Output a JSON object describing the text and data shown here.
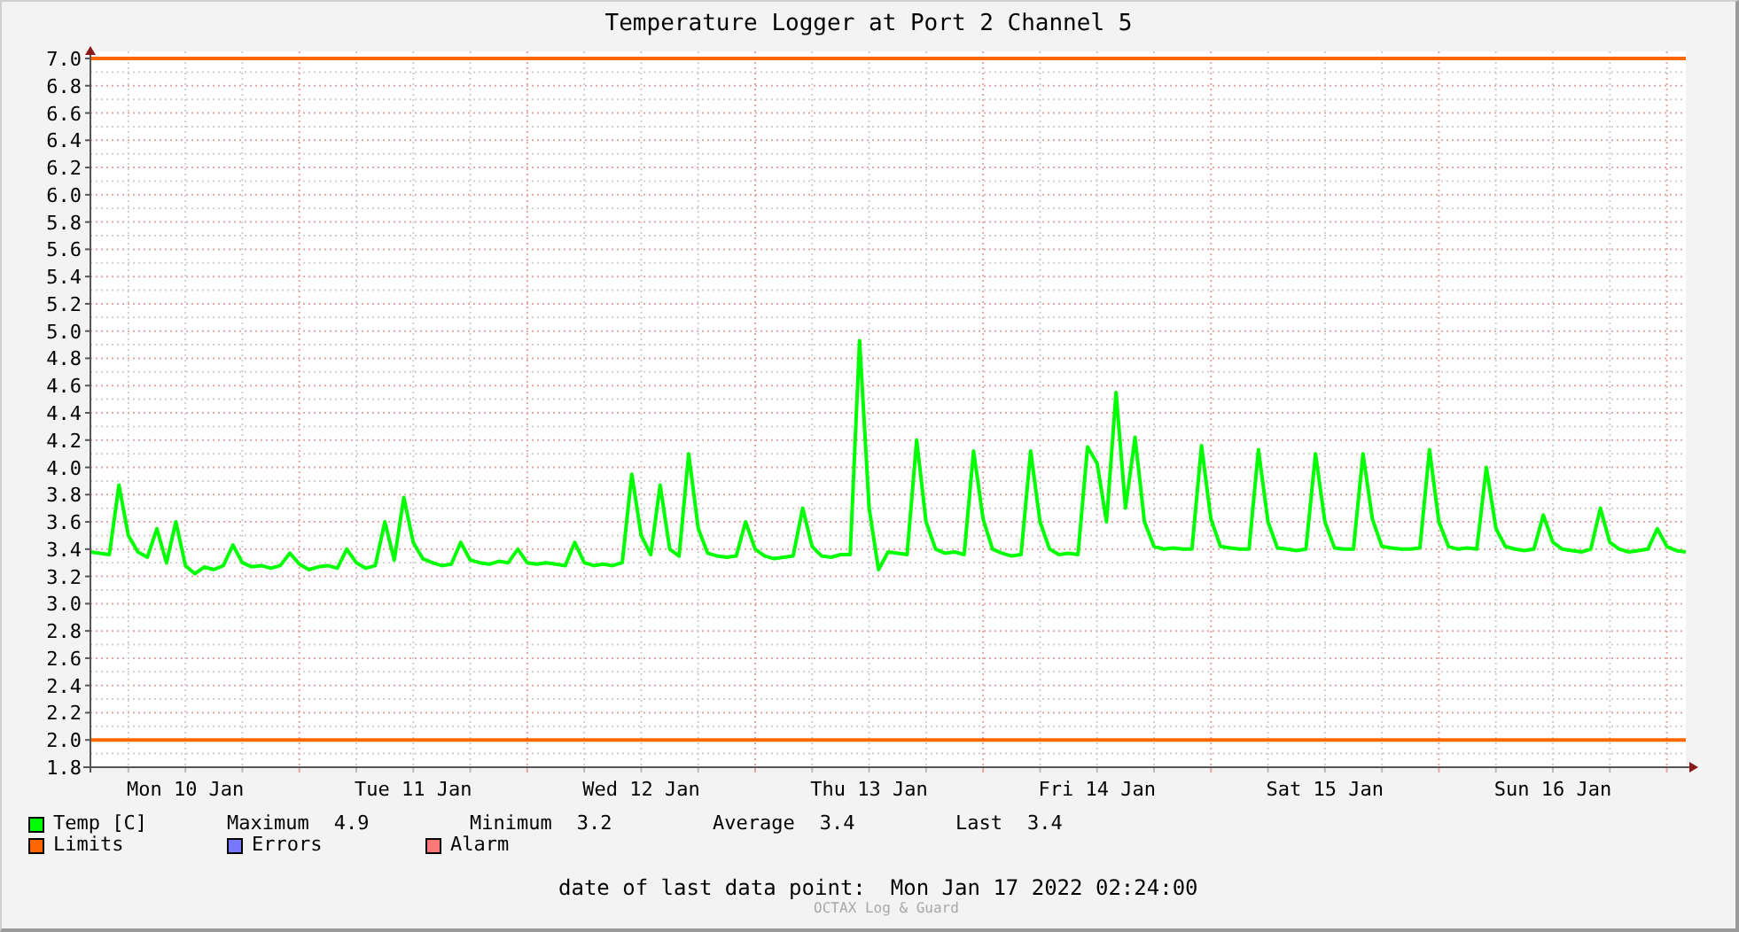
{
  "title": "Temperature Logger at Port 2 Channel 5",
  "chart_data": {
    "type": "line",
    "categories": [
      null,
      null,
      null,
      null,
      null,
      null,
      null,
      null,
      null,
      null,
      "Mon 10 Jan",
      null,
      null,
      null,
      null,
      null,
      null,
      null,
      null,
      null,
      null,
      null,
      null,
      null,
      null,
      null,
      null,
      null,
      null,
      null,
      null,
      null,
      null,
      null,
      "Tue 11 Jan",
      null,
      null,
      null,
      null,
      null,
      null,
      null,
      null,
      null,
      null,
      null,
      null,
      null,
      null,
      null,
      null,
      null,
      null,
      null,
      null,
      null,
      null,
      null,
      "Wed 12 Jan",
      null,
      null,
      null,
      null,
      null,
      null,
      null,
      null,
      null,
      null,
      null,
      null,
      null,
      null,
      null,
      null,
      null,
      null,
      null,
      null,
      null,
      null,
      null,
      "Thu 13 Jan",
      null,
      null,
      null,
      null,
      null,
      null,
      null,
      null,
      null,
      null,
      null,
      null,
      null,
      null,
      null,
      null,
      null,
      null,
      null,
      null,
      null,
      null,
      null,
      "Fri 14 Jan",
      null,
      null,
      null,
      null,
      null,
      null,
      null,
      null,
      null,
      null,
      null,
      null,
      null,
      null,
      null,
      null,
      null,
      null,
      null,
      null,
      null,
      null,
      null,
      "Sat 15 Jan",
      null,
      null,
      null,
      null,
      null,
      null,
      null,
      null,
      null,
      null,
      null,
      null,
      null,
      null,
      null,
      null,
      null,
      null,
      null,
      null,
      null,
      null,
      null,
      "Sun 16 Jan",
      null,
      null,
      null,
      null,
      null,
      null,
      null,
      null,
      null,
      null,
      null,
      null,
      null,
      null
    ],
    "series": [
      {
        "name": "Temp [C]",
        "color": "#00ff00",
        "values": [
          3.38,
          3.37,
          3.36,
          3.87,
          3.5,
          3.38,
          3.34,
          3.55,
          3.3,
          3.6,
          3.28,
          3.22,
          3.27,
          3.25,
          3.28,
          3.43,
          3.3,
          3.27,
          3.28,
          3.26,
          3.28,
          3.37,
          3.29,
          3.25,
          3.27,
          3.28,
          3.26,
          3.4,
          3.3,
          3.26,
          3.28,
          3.6,
          3.32,
          3.78,
          3.45,
          3.33,
          3.3,
          3.28,
          3.29,
          3.45,
          3.32,
          3.3,
          3.29,
          3.31,
          3.3,
          3.4,
          3.3,
          3.29,
          3.3,
          3.29,
          3.28,
          3.45,
          3.3,
          3.28,
          3.29,
          3.28,
          3.3,
          3.95,
          3.5,
          3.36,
          3.87,
          3.4,
          3.35,
          4.1,
          3.55,
          3.37,
          3.35,
          3.34,
          3.35,
          3.6,
          3.4,
          3.35,
          3.33,
          3.34,
          3.35,
          3.7,
          3.42,
          3.35,
          3.34,
          3.36,
          3.36,
          4.93,
          3.7,
          3.25,
          3.38,
          3.37,
          3.36,
          4.2,
          3.6,
          3.4,
          3.37,
          3.38,
          3.36,
          4.12,
          3.62,
          3.4,
          3.37,
          3.35,
          3.36,
          4.12,
          3.6,
          3.4,
          3.36,
          3.37,
          3.36,
          4.15,
          4.03,
          3.6,
          4.55,
          3.7,
          4.22,
          3.6,
          3.42,
          3.4,
          3.41,
          3.4,
          3.4,
          4.16,
          3.62,
          3.42,
          3.41,
          3.4,
          3.4,
          4.13,
          3.6,
          3.41,
          3.4,
          3.39,
          3.4,
          4.1,
          3.6,
          3.41,
          3.4,
          3.4,
          4.1,
          3.62,
          3.42,
          3.41,
          3.4,
          3.4,
          3.41,
          4.13,
          3.6,
          3.42,
          3.4,
          3.41,
          3.4,
          4.0,
          3.55,
          3.42,
          3.4,
          3.39,
          3.4,
          3.65,
          3.45,
          3.4,
          3.39,
          3.38,
          3.4,
          3.7,
          3.45,
          3.4,
          3.38,
          3.39,
          3.4,
          3.55,
          3.42,
          3.39,
          3.38
        ]
      }
    ],
    "ylim": [
      1.8,
      7.0
    ],
    "grid": true,
    "yticks": [
      {
        "value": 1.8,
        "label": "1.8"
      },
      {
        "value": 2.0,
        "label": "2.0"
      },
      {
        "value": 2.2,
        "label": "2.2"
      },
      {
        "value": 2.4,
        "label": "2.4"
      },
      {
        "value": 2.6,
        "label": "2.6"
      },
      {
        "value": 2.8,
        "label": "2.8"
      },
      {
        "value": 3.0,
        "label": "3.0"
      },
      {
        "value": 3.2,
        "label": "3.2"
      },
      {
        "value": 3.4,
        "label": "3.4"
      },
      {
        "value": 3.6,
        "label": "3.6"
      },
      {
        "value": 3.8,
        "label": "3.8"
      },
      {
        "value": 4.0,
        "label": "4.0"
      },
      {
        "value": 4.2,
        "label": "4.2"
      },
      {
        "value": 4.4,
        "label": "4.4"
      },
      {
        "value": 4.6,
        "label": "4.6"
      },
      {
        "value": 4.8,
        "label": "4.8"
      },
      {
        "value": 5.0,
        "label": "5.0"
      },
      {
        "value": 5.2,
        "label": "5.2"
      },
      {
        "value": 5.4,
        "label": "5.4"
      },
      {
        "value": 5.6,
        "label": "5.6"
      },
      {
        "value": 5.8,
        "label": "5.8"
      },
      {
        "value": 6.0,
        "label": "6.0"
      },
      {
        "value": 6.2,
        "label": "6.2"
      },
      {
        "value": 6.4,
        "label": "6.4"
      },
      {
        "value": 6.6,
        "label": "6.6"
      },
      {
        "value": 6.8,
        "label": "6.8"
      },
      {
        "value": 7.0,
        "label": "7.0"
      }
    ],
    "ref_lines": [
      {
        "axis": "y",
        "value": 7.0,
        "color": "#ff6600"
      },
      {
        "axis": "y",
        "value": 2.0,
        "color": "#ff6600"
      }
    ]
  },
  "legend": [
    {
      "stats": [
        {
          "label": "Maximum",
          "value": "4.9"
        },
        {
          "label": "Minimum",
          "value": "3.2"
        },
        {
          "label": "Average",
          "value": "3.4"
        },
        {
          "label": "Last",
          "value": "3.4"
        }
      ]
    },
    {
      "label": "Limits",
      "color": "#ff6600"
    },
    {
      "label": "Errors",
      "color": "#7777ff"
    },
    {
      "label": "Alarm",
      "color": "#ff7777"
    }
  ],
  "footer": {
    "label": "date of last data point:",
    "value": "Mon Jan 17 2022 02:24:00"
  },
  "watermark": "OCTAX Log & Guard"
}
